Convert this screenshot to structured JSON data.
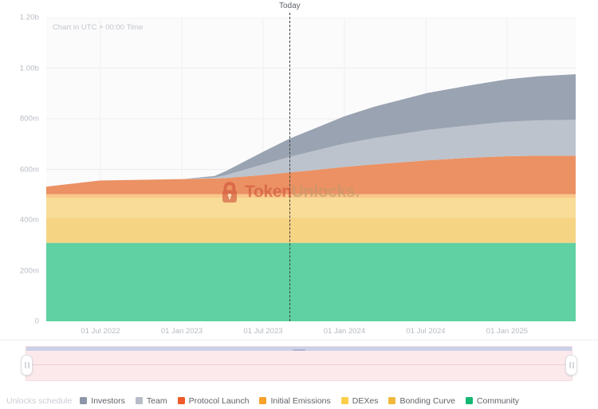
{
  "header": {
    "today_label": "Today",
    "utc_note": "Chart in UTC + 00:00 Time"
  },
  "watermark": {
    "icon": "lock-icon",
    "text_primary": "Token",
    "text_secondary": "Unlocks."
  },
  "legend": {
    "title": "Unlocks schedule",
    "items": [
      {
        "label": "Investors",
        "color": "#8d96a8"
      },
      {
        "label": "Team",
        "color": "#b6bdc9"
      },
      {
        "label": "Protocol Launch",
        "color": "#ef5a28"
      },
      {
        "label": "Initial Emissions",
        "color": "#f9a22b"
      },
      {
        "label": "DEXes",
        "color": "#fbcf4a"
      },
      {
        "label": "Bonding Curve",
        "color": "#f0b93c"
      },
      {
        "label": "Community",
        "color": "#14b873"
      }
    ]
  },
  "range_selector": {
    "name": "time-range-selector",
    "left_handle": "range-handle-left",
    "right_handle": "range-handle-right"
  },
  "chart_data": {
    "type": "area",
    "stacked": true,
    "title": "",
    "subtitle": "Chart in UTC + 00:00 Time",
    "xlabel": "",
    "ylabel": "",
    "ylim": [
      0,
      1200000000
    ],
    "grid": true,
    "legend_position": "bottom",
    "y_ticks": [
      {
        "value": 1200000000,
        "label": "1.20b"
      },
      {
        "value": 1000000000,
        "label": "1.00b"
      },
      {
        "value": 800000000,
        "label": "800m"
      },
      {
        "value": 600000000,
        "label": "600m"
      },
      {
        "value": 400000000,
        "label": "400m"
      },
      {
        "value": 200000000,
        "label": "200m"
      },
      {
        "value": 0,
        "label": "0"
      }
    ],
    "x_ticks": [
      {
        "pos": 0.1024,
        "label": "01 Jul 2022"
      },
      {
        "pos": 0.256,
        "label": "01 Jan 2023"
      },
      {
        "pos": 0.4096,
        "label": "01 Jul 2023"
      },
      {
        "pos": 0.5632,
        "label": "01 Jan 2024"
      },
      {
        "pos": 0.7168,
        "label": "01 Jul 2024"
      },
      {
        "pos": 0.8704,
        "label": "01 Jan 2025"
      }
    ],
    "today_marker": {
      "pos": 0.4598,
      "label": "Today"
    },
    "x": [
      0.0,
      0.1,
      0.26,
      0.318,
      0.34,
      0.41,
      0.46,
      0.5,
      0.5632,
      0.62,
      0.72,
      0.8,
      0.87,
      0.93,
      1.0
    ],
    "series": [
      {
        "name": "Community",
        "color": "#5fd1a2",
        "values": [
          310000000,
          310000000,
          310000000,
          310000000,
          310000000,
          310000000,
          310000000,
          310000000,
          310000000,
          310000000,
          310000000,
          310000000,
          310000000,
          310000000,
          310000000
        ]
      },
      {
        "name": "Bonding Curve",
        "color": "#f5d484",
        "values": [
          100000000,
          100000000,
          100000000,
          100000000,
          100000000,
          100000000,
          100000000,
          100000000,
          100000000,
          100000000,
          100000000,
          100000000,
          100000000,
          100000000,
          100000000
        ]
      },
      {
        "name": "DEXes",
        "color": "#f8dc97",
        "values": [
          78000000,
          78000000,
          78000000,
          78000000,
          78000000,
          78000000,
          78000000,
          78000000,
          78000000,
          78000000,
          78000000,
          78000000,
          78000000,
          78000000,
          78000000
        ]
      },
      {
        "name": "Initial Emissions",
        "color": "#fac88a",
        "values": [
          14000000,
          14000000,
          14000000,
          14000000,
          14000000,
          14000000,
          14000000,
          14000000,
          14000000,
          14000000,
          14000000,
          14000000,
          14000000,
          14000000,
          14000000
        ]
      },
      {
        "name": "Protocol Launch",
        "color": "#eb9163",
        "values": [
          30000000,
          54000000,
          60000000,
          62000000,
          64000000,
          76000000,
          86000000,
          94000000,
          108000000,
          118000000,
          134000000,
          144000000,
          150000000,
          152000000,
          152000000
        ]
      },
      {
        "name": "Team",
        "color": "#bcc3cd",
        "values": [
          0,
          0,
          0,
          4000000,
          12000000,
          42000000,
          62000000,
          74000000,
          92000000,
          104000000,
          120000000,
          128000000,
          136000000,
          140000000,
          142000000
        ]
      },
      {
        "name": "Investors",
        "color": "#9aa3b1",
        "values": [
          0,
          0,
          0,
          6000000,
          16000000,
          50000000,
          72000000,
          86000000,
          108000000,
          124000000,
          146000000,
          158000000,
          168000000,
          174000000,
          180000000
        ]
      }
    ]
  }
}
